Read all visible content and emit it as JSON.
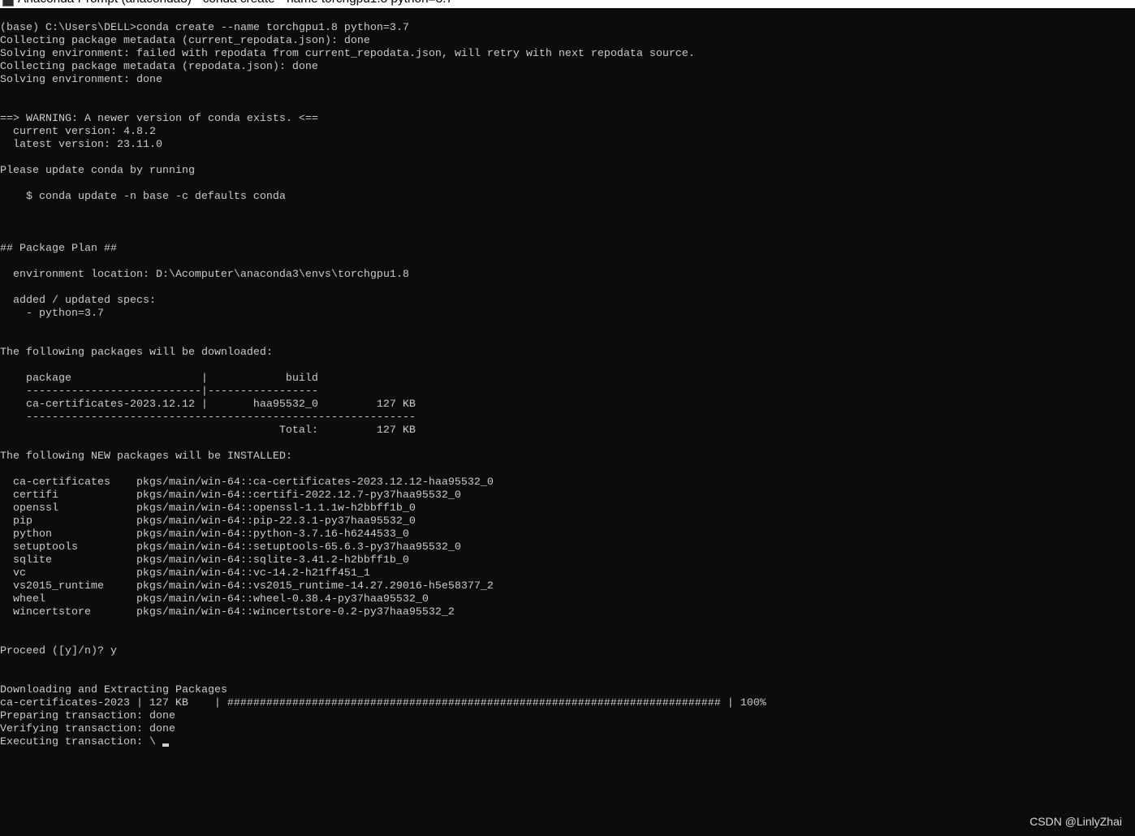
{
  "window": {
    "title": "Anaconda Prompt (anaconda3) - conda create --name torchgpu1.8 python=3.7",
    "icon": "console-icon"
  },
  "theme": {
    "background": "#0c0c0c",
    "foreground": "#cccccc",
    "titlebar": "#ffffff"
  },
  "console": {
    "prompt": "(base) C:\\Users\\DELL>",
    "command": "conda create --name torchgpu1.8 python=3.7",
    "status": [
      "Collecting package metadata (current_repodata.json): done",
      "Solving environment: failed with repodata from current_repodata.json, will retry with next repodata source.",
      "Collecting package metadata (repodata.json): done",
      "Solving environment: done"
    ],
    "warning": {
      "banner": "==> WARNING: A newer version of conda exists. <==",
      "current": "current version: 4.8.2",
      "latest": "latest version: 23.11.0",
      "hint": "Please update conda by running",
      "update_command": "$ conda update -n base -c defaults conda"
    },
    "package_plan": {
      "heading": "## Package Plan ##",
      "environment_location": "environment location: D:\\Acomputer\\anaconda3\\envs\\torchgpu1.8",
      "specs_heading": "added / updated specs:",
      "specs": [
        "- python=3.7"
      ]
    },
    "download": {
      "heading": "The following packages will be downloaded:",
      "column_package": "package",
      "column_build": "build",
      "separator": "|",
      "header_rule": "---------------------------|-----------------",
      "rows": [
        {
          "package": "ca-certificates-2023.12.12",
          "build": "haa95532_0",
          "size": "127 KB"
        }
      ],
      "total_rule": "------------------------------------------------------------",
      "total_label": "Total:",
      "total_size": "127 KB"
    },
    "install": {
      "heading": "The following NEW packages will be INSTALLED:",
      "packages": [
        {
          "name": "ca-certificates",
          "spec": "pkgs/main/win-64::ca-certificates-2023.12.12-haa95532_0"
        },
        {
          "name": "certifi",
          "spec": "pkgs/main/win-64::certifi-2022.12.7-py37haa95532_0"
        },
        {
          "name": "openssl",
          "spec": "pkgs/main/win-64::openssl-1.1.1w-h2bbff1b_0"
        },
        {
          "name": "pip",
          "spec": "pkgs/main/win-64::pip-22.3.1-py37haa95532_0"
        },
        {
          "name": "python",
          "spec": "pkgs/main/win-64::python-3.7.16-h6244533_0"
        },
        {
          "name": "setuptools",
          "spec": "pkgs/main/win-64::setuptools-65.6.3-py37haa95532_0"
        },
        {
          "name": "sqlite",
          "spec": "pkgs/main/win-64::sqlite-3.41.2-h2bbff1b_0"
        },
        {
          "name": "vc",
          "spec": "pkgs/main/win-64::vc-14.2-h21ff451_1"
        },
        {
          "name": "vs2015_runtime",
          "spec": "pkgs/main/win-64::vs2015_runtime-14.27.29016-h5e58377_2"
        },
        {
          "name": "wheel",
          "spec": "pkgs/main/win-64::wheel-0.38.4-py37haa95532_0"
        },
        {
          "name": "wincertstore",
          "spec": "pkgs/main/win-64::wincertstore-0.2-py37haa95532_2"
        }
      ]
    },
    "proceed": {
      "question": "Proceed ([y]/n)?",
      "answer": "y"
    },
    "progress": {
      "heading": "Downloading and Extracting Packages",
      "package": "ca-certificates-2023",
      "size": "127 KB",
      "separator": "|",
      "bar": "############################################################################",
      "percent": "100%"
    },
    "transaction": {
      "preparing": "Preparing transaction: done",
      "verifying": "Verifying transaction: done",
      "executing": "Executing transaction: \\"
    }
  },
  "watermark": "CSDN @LinlyZhai"
}
